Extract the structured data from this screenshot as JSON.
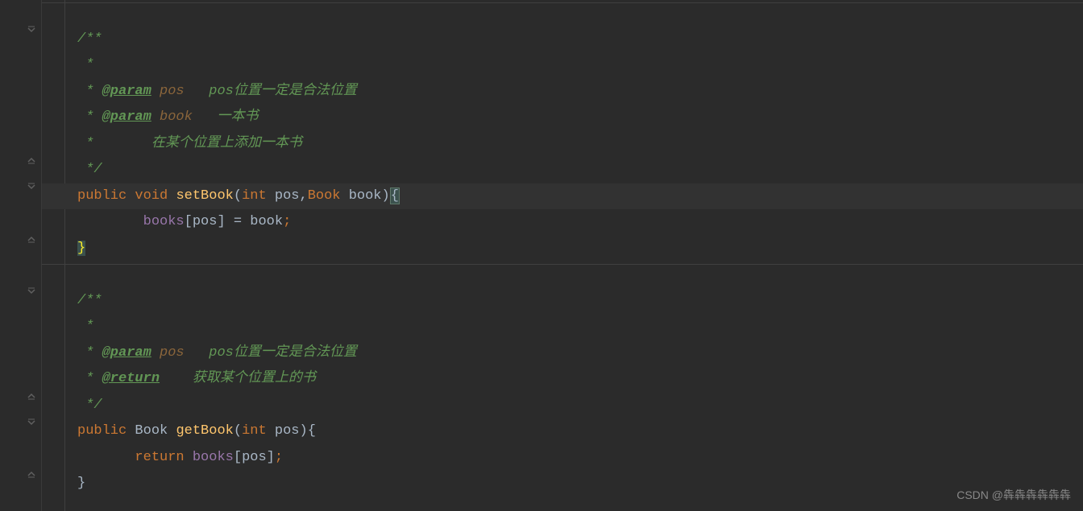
{
  "lines": [
    {
      "type": "blank",
      "hr": true
    },
    {
      "type": "javadoc-start",
      "text": "/**"
    },
    {
      "type": "javadoc-line",
      "text": " *"
    },
    {
      "type": "javadoc-param",
      "prefix": " * ",
      "tag": "@param",
      "param": " pos",
      "desc": "   pos位置一定是合法位置"
    },
    {
      "type": "javadoc-param",
      "prefix": " * ",
      "tag": "@param",
      "param": " book",
      "desc": "   一本书"
    },
    {
      "type": "javadoc-line",
      "text": " *       在某个位置上添加一本书"
    },
    {
      "type": "javadoc-end",
      "text": " */"
    },
    {
      "type": "method-sig",
      "current": true,
      "keyword1": "public",
      "keyword2": "void",
      "method": "setBook",
      "params": [
        {
          "type": "int",
          "name": "pos"
        },
        {
          "type": "Book",
          "name": "book"
        }
      ],
      "open_brace": "{"
    },
    {
      "type": "assign",
      "indent": "        ",
      "field": "books",
      "index": "pos",
      "op": " = ",
      "val": "book",
      "semi": ";"
    },
    {
      "type": "close-brace",
      "text": "}"
    },
    {
      "type": "blank",
      "hr": true
    },
    {
      "type": "javadoc-start",
      "text": "/**"
    },
    {
      "type": "javadoc-line",
      "text": " *"
    },
    {
      "type": "javadoc-param",
      "prefix": " * ",
      "tag": "@param",
      "param": " pos",
      "desc": "   pos位置一定是合法位置"
    },
    {
      "type": "javadoc-return",
      "prefix": " * ",
      "tag": "@return",
      "desc": "    获取某个位置上的书"
    },
    {
      "type": "javadoc-end",
      "text": " */"
    },
    {
      "type": "method-sig2",
      "keyword1": "public",
      "returnType": "Book",
      "method": "getBook",
      "params": [
        {
          "type": "int",
          "name": "pos"
        }
      ],
      "open_brace": "{"
    },
    {
      "type": "return",
      "indent": "       ",
      "keyword": "return",
      "field": "books",
      "index": "pos",
      "semi": ";"
    },
    {
      "type": "close-brace-plain",
      "text": "}"
    }
  ],
  "watermark": "CSDN @犇犇犇犇犇犇"
}
